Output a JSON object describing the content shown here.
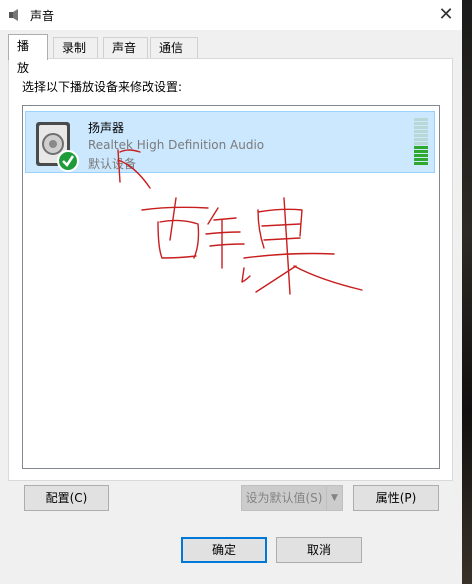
{
  "window": {
    "title": "声音",
    "close_glyph": "✕"
  },
  "tabs": [
    {
      "label": "播放",
      "active": true
    },
    {
      "label": "录制",
      "active": false
    },
    {
      "label": "声音",
      "active": false
    },
    {
      "label": "通信",
      "active": false
    }
  ],
  "playback": {
    "instruction": "选择以下播放设备来修改设置:",
    "devices": [
      {
        "name": "扬声器",
        "description": "Realtek High Definition Audio",
        "status": "默认设备",
        "icon": "speaker-icon",
        "badge": "checkmark-icon"
      }
    ],
    "level_meter": {
      "segments": 12,
      "active_segments": 5
    }
  },
  "buttons": {
    "configure": "配置(C)",
    "set_default": "设为默认值(S)",
    "properties": "属性(P)",
    "ok": "确定",
    "cancel": "取消"
  },
  "colors": {
    "selection_fill": "#cce8ff",
    "selection_border": "#99d1ff",
    "accent": "#0078d7",
    "meter_active": "#2fa82f",
    "annotation_ink": "#c81e1e"
  }
}
